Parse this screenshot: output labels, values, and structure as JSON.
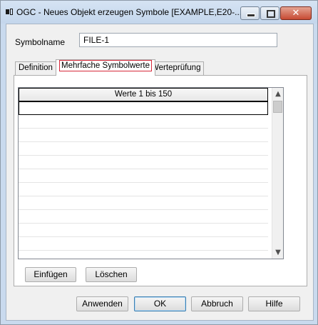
{
  "window": {
    "title": "OGC - Neues Objekt erzeugen Symbole [EXAMPLE,E20-..."
  },
  "form": {
    "symbolname_label": "Symbolname",
    "symbolname_value": "FILE-1"
  },
  "tabs": [
    {
      "label": "Definition",
      "active": false
    },
    {
      "label": "Mehrfache Symbolwerte",
      "active": true
    },
    {
      "label": "Werteprüfung",
      "active": false
    }
  ],
  "grid": {
    "header": "Werte 1 bis 150"
  },
  "panel_buttons": {
    "insert": "Einfügen",
    "delete": "Löschen"
  },
  "footer_buttons": {
    "apply": "Anwenden",
    "ok": "OK",
    "cancel": "Abbruch",
    "help": "Hilfe"
  }
}
